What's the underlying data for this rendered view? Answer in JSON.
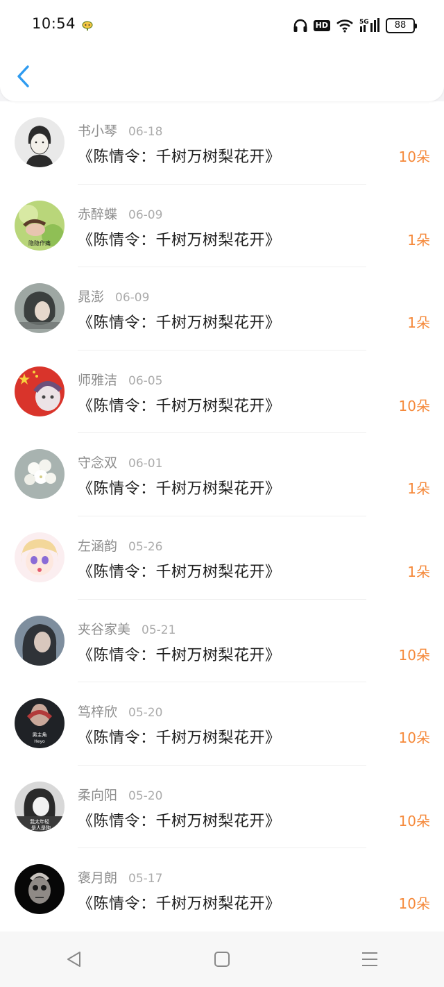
{
  "status_bar": {
    "time": "10:54",
    "battery": "88",
    "network": "5G",
    "hd_label": "HD"
  },
  "nav": {
    "back_icon": "chevron-left-icon",
    "accent_color": "#2e9bf0"
  },
  "list": {
    "amount_color": "#f5893a",
    "items": [
      {
        "name": "书小琴",
        "date": "06-18",
        "title": "《陈情令：千树万树梨花开》",
        "amount": "10朵"
      },
      {
        "name": "赤醉蝶",
        "date": "06-09",
        "title": "《陈情令：千树万树梨花开》",
        "amount": "1朵"
      },
      {
        "name": "晁澎",
        "date": "06-09",
        "title": "《陈情令：千树万树梨花开》",
        "amount": "1朵"
      },
      {
        "name": "师雅洁",
        "date": "06-05",
        "title": "《陈情令：千树万树梨花开》",
        "amount": "10朵"
      },
      {
        "name": "守念双",
        "date": "06-01",
        "title": "《陈情令：千树万树梨花开》",
        "amount": "1朵"
      },
      {
        "name": "左涵韵",
        "date": "05-26",
        "title": "《陈情令：千树万树梨花开》",
        "amount": "1朵"
      },
      {
        "name": "夹谷家美",
        "date": "05-21",
        "title": "《陈情令：千树万树梨花开》",
        "amount": "10朵"
      },
      {
        "name": "笃梓欣",
        "date": "05-20",
        "title": "《陈情令：千树万树梨花开》",
        "amount": "10朵"
      },
      {
        "name": "柔向阳",
        "date": "05-20",
        "title": "《陈情令：千树万树梨花开》",
        "amount": "10朵"
      },
      {
        "name": "褒月朗",
        "date": "05-17",
        "title": "《陈情令：千树万树梨花开》",
        "amount": "10朵"
      }
    ]
  },
  "avatar_overlays": {
    "item_1": "隐隐作痛",
    "item_7_line1": "男主角",
    "item_7_line2": "Heyo",
    "item_8_line1": "我太年轻",
    "item_8_line2": "是人是狗"
  },
  "system_nav": {
    "back": "triangle-back-icon",
    "home": "square-home-icon",
    "menu": "menu-lines-icon"
  }
}
